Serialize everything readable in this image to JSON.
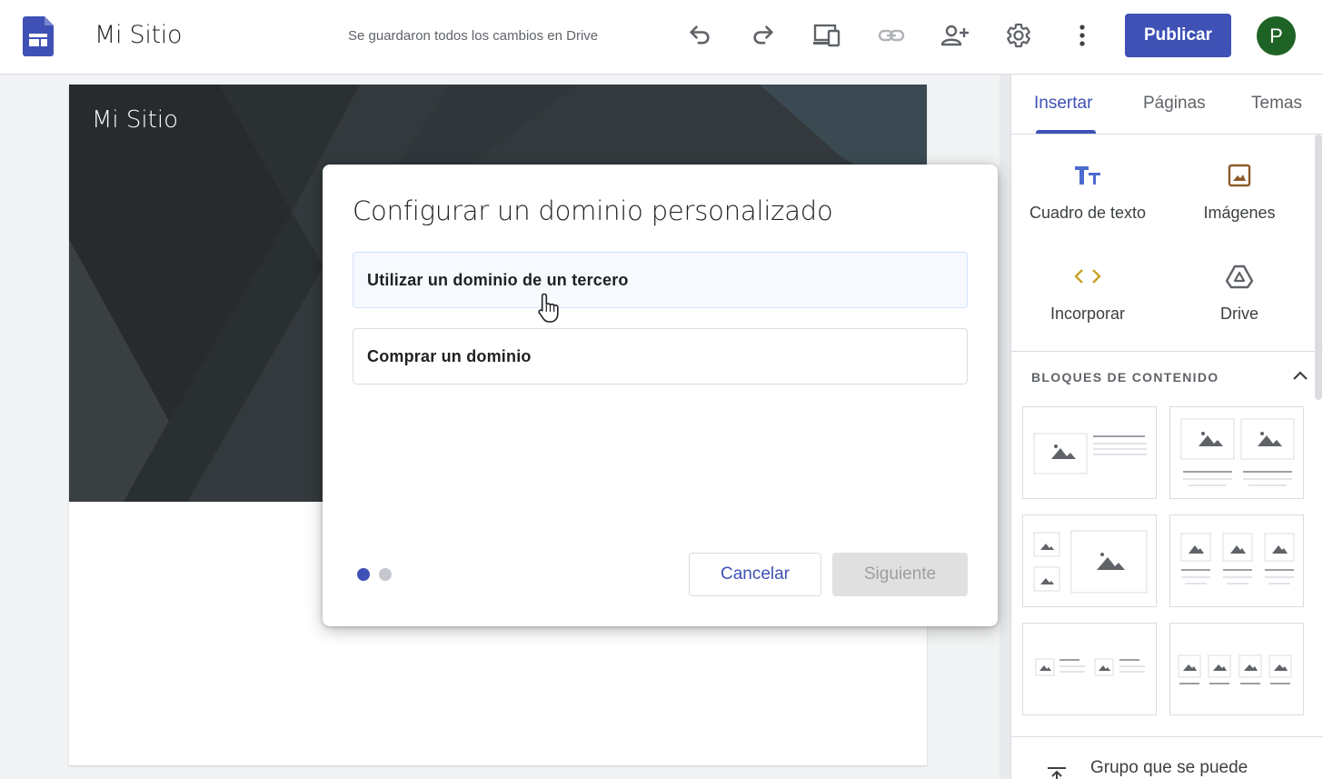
{
  "app": {
    "title": "Mi Sitio",
    "save_status": "Se guardaron todos los cambios en Drive",
    "publish_label": "Publicar",
    "avatar_initial": "P",
    "accent_color": "#3f51b5",
    "avatar_color": "#1e6325"
  },
  "toolbar": {
    "icons": [
      "undo-icon",
      "redo-icon",
      "preview-devices-icon",
      "link-icon",
      "share-person-add-icon",
      "settings-gear-icon",
      "more-vert-icon"
    ]
  },
  "site": {
    "title": "Mi Sitio"
  },
  "panel": {
    "tabs": [
      {
        "label": "Insertar",
        "active": true
      },
      {
        "label": "Páginas",
        "active": false
      },
      {
        "label": "Temas",
        "active": false
      }
    ],
    "insert_items": [
      {
        "label": "Cuadro de texto",
        "icon": "text-box-icon"
      },
      {
        "label": "Imágenes",
        "icon": "image-icon"
      },
      {
        "label": "Incorporar",
        "icon": "embed-code-icon"
      },
      {
        "label": "Drive",
        "icon": "drive-icon"
      }
    ],
    "content_blocks_title": "BLOQUES DE CONTENIDO",
    "group_label": "Grupo que se puede"
  },
  "dialog": {
    "title": "Configurar un dominio personalizado",
    "options": [
      {
        "label": "Utilizar un dominio de un tercero"
      },
      {
        "label": "Comprar un dominio"
      }
    ],
    "step_current": 1,
    "step_total": 2,
    "cancel_label": "Cancelar",
    "next_label": "Siguiente"
  }
}
